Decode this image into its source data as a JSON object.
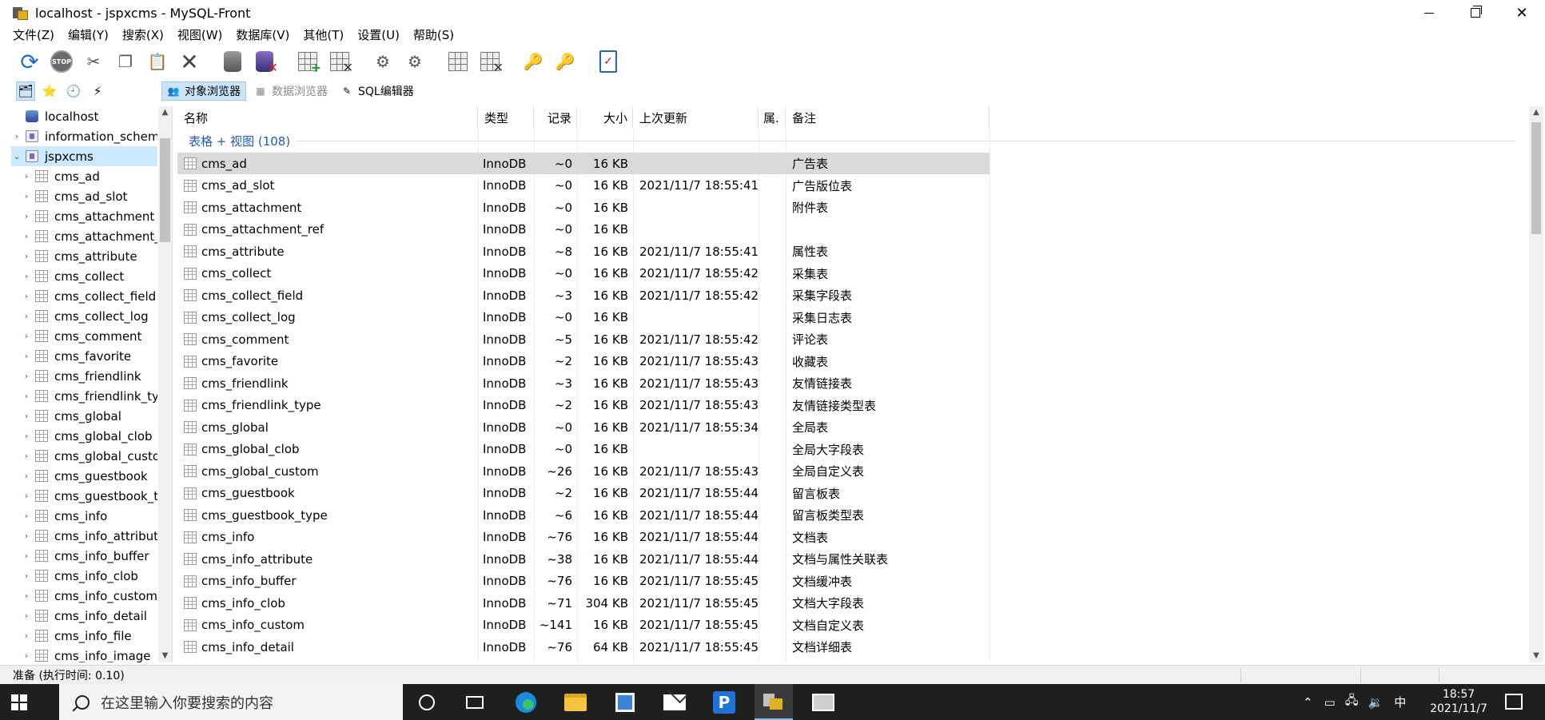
{
  "window": {
    "title": "localhost - jspxcms - MySQL-Front"
  },
  "menu": [
    "文件(Z)",
    "编辑(Y)",
    "搜索(X)",
    "视图(W)",
    "数据库(V)",
    "其他(T)",
    "设置(U)",
    "帮助(S)"
  ],
  "toolbar": {
    "stop_label": "STOP",
    "icons": [
      "refresh-icon",
      "stop-icon",
      "cut-icon",
      "copy-icon",
      "paste-icon",
      "delete-icon",
      "db-icon",
      "drop-db-icon",
      "add-table-icon",
      "drop-table-icon",
      "add-column-icon",
      "remove-column-icon",
      "add-index-icon",
      "remove-index-icon",
      "add-key-icon",
      "remove-key-icon",
      "checklist-icon"
    ]
  },
  "view_tabs": {
    "object_browser": "对象浏览器",
    "data_browser": "数据浏览器",
    "sql_editor": "SQL编辑器"
  },
  "tree": {
    "server": "localhost",
    "databases": [
      "information_schema",
      "jspxcms"
    ],
    "tables": [
      "cms_ad",
      "cms_ad_slot",
      "cms_attachment",
      "cms_attachment_ref",
      "cms_attribute",
      "cms_collect",
      "cms_collect_field",
      "cms_collect_log",
      "cms_comment",
      "cms_favorite",
      "cms_friendlink",
      "cms_friendlink_type",
      "cms_global",
      "cms_global_clob",
      "cms_global_custom",
      "cms_guestbook",
      "cms_guestbook_type",
      "cms_info",
      "cms_info_attribute",
      "cms_info_buffer",
      "cms_info_clob",
      "cms_info_custom",
      "cms_info_detail",
      "cms_info_file",
      "cms_info_image"
    ]
  },
  "grid": {
    "columns": {
      "name": "名称",
      "type": "类型",
      "records": "记录",
      "size": "大小",
      "updated": "上次更新",
      "attr": "属.",
      "comment": "备注"
    },
    "group_label": "表格 + 视图 (108)",
    "rows": [
      {
        "name": "cms_ad",
        "type": "InnoDB",
        "records": "~0",
        "size": "16 KB",
        "updated": "",
        "comment": "广告表"
      },
      {
        "name": "cms_ad_slot",
        "type": "InnoDB",
        "records": "~0",
        "size": "16 KB",
        "updated": "2021/11/7 18:55:41",
        "comment": "广告版位表"
      },
      {
        "name": "cms_attachment",
        "type": "InnoDB",
        "records": "~0",
        "size": "16 KB",
        "updated": "",
        "comment": "附件表"
      },
      {
        "name": "cms_attachment_ref",
        "type": "InnoDB",
        "records": "~0",
        "size": "16 KB",
        "updated": "",
        "comment": ""
      },
      {
        "name": "cms_attribute",
        "type": "InnoDB",
        "records": "~8",
        "size": "16 KB",
        "updated": "2021/11/7 18:55:41",
        "comment": "属性表"
      },
      {
        "name": "cms_collect",
        "type": "InnoDB",
        "records": "~0",
        "size": "16 KB",
        "updated": "2021/11/7 18:55:42",
        "comment": "采集表"
      },
      {
        "name": "cms_collect_field",
        "type": "InnoDB",
        "records": "~3",
        "size": "16 KB",
        "updated": "2021/11/7 18:55:42",
        "comment": "采集字段表"
      },
      {
        "name": "cms_collect_log",
        "type": "InnoDB",
        "records": "~0",
        "size": "16 KB",
        "updated": "",
        "comment": "采集日志表"
      },
      {
        "name": "cms_comment",
        "type": "InnoDB",
        "records": "~5",
        "size": "16 KB",
        "updated": "2021/11/7 18:55:42",
        "comment": "评论表"
      },
      {
        "name": "cms_favorite",
        "type": "InnoDB",
        "records": "~2",
        "size": "16 KB",
        "updated": "2021/11/7 18:55:43",
        "comment": "收藏表"
      },
      {
        "name": "cms_friendlink",
        "type": "InnoDB",
        "records": "~3",
        "size": "16 KB",
        "updated": "2021/11/7 18:55:43",
        "comment": "友情链接表"
      },
      {
        "name": "cms_friendlink_type",
        "type": "InnoDB",
        "records": "~2",
        "size": "16 KB",
        "updated": "2021/11/7 18:55:43",
        "comment": "友情链接类型表"
      },
      {
        "name": "cms_global",
        "type": "InnoDB",
        "records": "~0",
        "size": "16 KB",
        "updated": "2021/11/7 18:55:34",
        "comment": "全局表"
      },
      {
        "name": "cms_global_clob",
        "type": "InnoDB",
        "records": "~0",
        "size": "16 KB",
        "updated": "",
        "comment": "全局大字段表"
      },
      {
        "name": "cms_global_custom",
        "type": "InnoDB",
        "records": "~26",
        "size": "16 KB",
        "updated": "2021/11/7 18:55:43",
        "comment": "全局自定义表"
      },
      {
        "name": "cms_guestbook",
        "type": "InnoDB",
        "records": "~2",
        "size": "16 KB",
        "updated": "2021/11/7 18:55:44",
        "comment": "留言板表"
      },
      {
        "name": "cms_guestbook_type",
        "type": "InnoDB",
        "records": "~6",
        "size": "16 KB",
        "updated": "2021/11/7 18:55:44",
        "comment": "留言板类型表"
      },
      {
        "name": "cms_info",
        "type": "InnoDB",
        "records": "~76",
        "size": "16 KB",
        "updated": "2021/11/7 18:55:44",
        "comment": "文档表"
      },
      {
        "name": "cms_info_attribute",
        "type": "InnoDB",
        "records": "~38",
        "size": "16 KB",
        "updated": "2021/11/7 18:55:44",
        "comment": "文档与属性关联表"
      },
      {
        "name": "cms_info_buffer",
        "type": "InnoDB",
        "records": "~76",
        "size": "16 KB",
        "updated": "2021/11/7 18:55:45",
        "comment": "文档缓冲表"
      },
      {
        "name": "cms_info_clob",
        "type": "InnoDB",
        "records": "~71",
        "size": "304 KB",
        "updated": "2021/11/7 18:55:45",
        "comment": "文档大字段表"
      },
      {
        "name": "cms_info_custom",
        "type": "InnoDB",
        "records": "~141",
        "size": "16 KB",
        "updated": "2021/11/7 18:55:45",
        "comment": "文档自定义表"
      },
      {
        "name": "cms_info_detail",
        "type": "InnoDB",
        "records": "~76",
        "size": "64 KB",
        "updated": "2021/11/7 18:55:45",
        "comment": "文档详细表"
      }
    ]
  },
  "status": {
    "text": "准备 (执行时间: 0.10)"
  },
  "taskbar": {
    "search_placeholder": "在这里输入你要搜索的内容",
    "ime": "中",
    "time": "18:57",
    "date": "2021/11/7"
  }
}
